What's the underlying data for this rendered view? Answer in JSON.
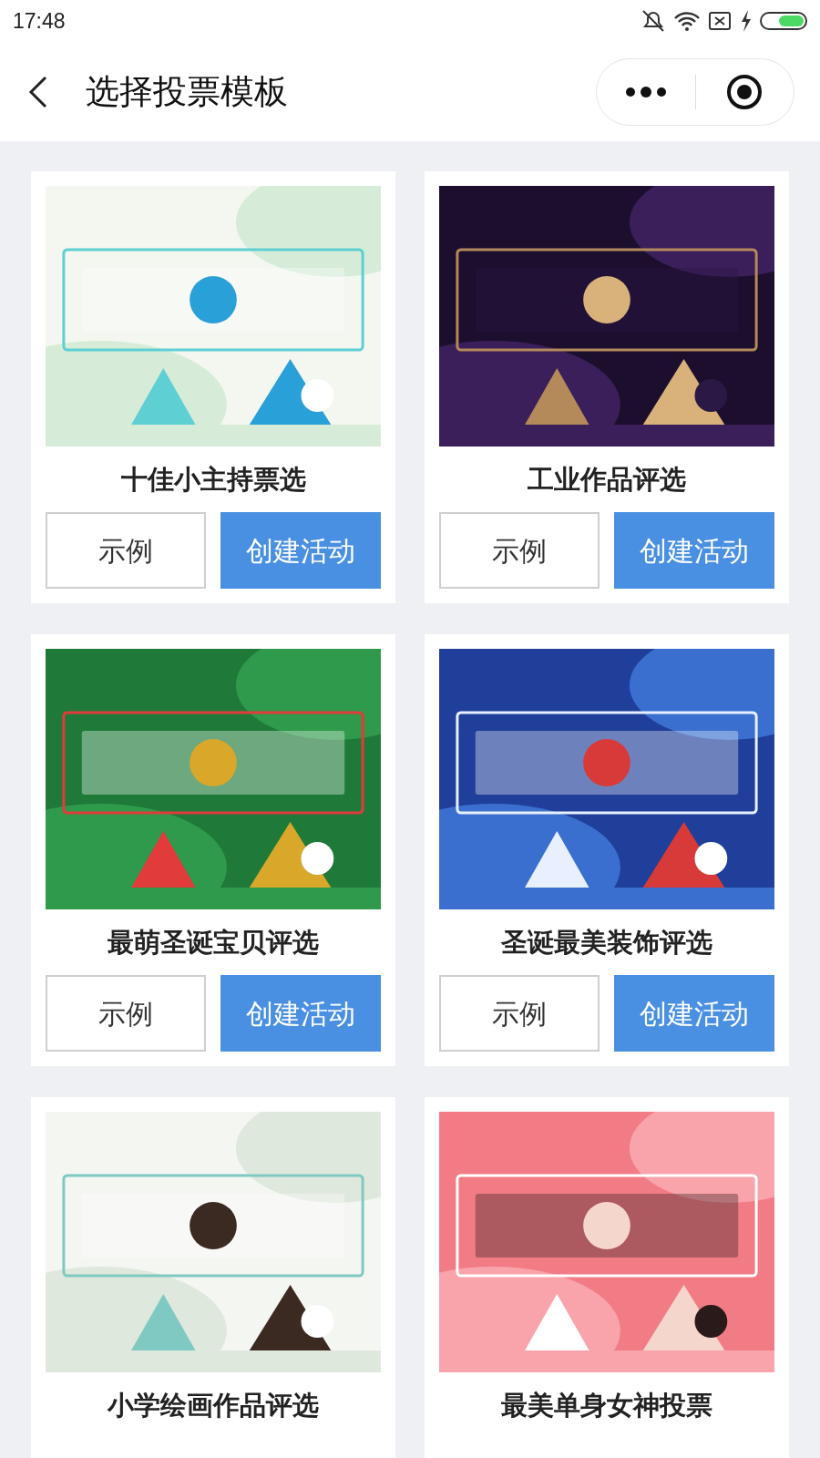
{
  "status_bar": {
    "time": "17:48"
  },
  "header": {
    "title": "选择投票模板"
  },
  "templates": [
    {
      "title": "十佳小主持票选",
      "buttons": [
        {
          "label": "示例",
          "kind": "outline"
        },
        {
          "label": "创建活动",
          "kind": "primary"
        }
      ]
    },
    {
      "title": "工业作品评选",
      "buttons": [
        {
          "label": "示例",
          "kind": "outline"
        },
        {
          "label": "创建活动",
          "kind": "primary"
        }
      ]
    },
    {
      "title": "最萌圣诞宝贝评选",
      "buttons": [
        {
          "label": "示例",
          "kind": "outline"
        },
        {
          "label": "创建活动",
          "kind": "primary"
        }
      ]
    },
    {
      "title": "圣诞最美装饰评选",
      "buttons": [
        {
          "label": "示例",
          "kind": "outline"
        },
        {
          "label": "创建活动",
          "kind": "primary"
        }
      ]
    },
    {
      "title": "小学绘画作品评选"
    },
    {
      "title": "最美单身女神投票"
    }
  ]
}
